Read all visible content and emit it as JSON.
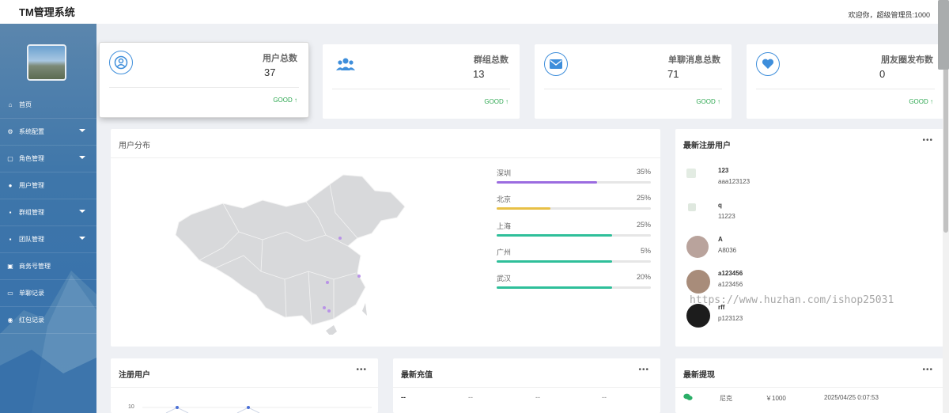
{
  "header": {
    "title": "TM管理系统",
    "welcome": "欢迎你，超级管理员:1000"
  },
  "sidebar": {
    "items": [
      {
        "label": "首页",
        "icon": "home-icon",
        "caret": false
      },
      {
        "label": "系统配置",
        "icon": "gear-icon",
        "caret": true
      },
      {
        "label": "角色管理",
        "icon": "lock-icon",
        "caret": true
      },
      {
        "label": "用户管理",
        "icon": "user-icon",
        "caret": false
      },
      {
        "label": "群组管理",
        "icon": "group-icon",
        "caret": true
      },
      {
        "label": "团队管理",
        "icon": "team-icon",
        "caret": true
      },
      {
        "label": "商务号管理",
        "icon": "contact-card-icon",
        "caret": false
      },
      {
        "label": "单聊记录",
        "icon": "chat-icon",
        "caret": false
      },
      {
        "label": "红包记录",
        "icon": "red-packet-icon",
        "caret": false
      }
    ]
  },
  "stats": [
    {
      "label": "用户总数",
      "value": "37",
      "status": "GOOD ↑",
      "icon": "user-circle-icon"
    },
    {
      "label": "群组总数",
      "value": "13",
      "status": "GOOD ↑",
      "icon": "users-group-icon"
    },
    {
      "label": "单聊消息总数",
      "value": "71",
      "status": "GOOD ↑",
      "icon": "envelope-icon"
    },
    {
      "label": "朋友圈发布数",
      "value": "0",
      "status": "GOOD ↑",
      "icon": "heart-icon"
    }
  ],
  "distribution": {
    "title": "用户分布",
    "cities": [
      {
        "name": "深圳",
        "pct": "35%",
        "fill": 0.65,
        "color": "#9b6ce0"
      },
      {
        "name": "北京",
        "pct": "25%",
        "fill": 0.35,
        "color": "#e8c046"
      },
      {
        "name": "上海",
        "pct": "25%",
        "fill": 0.75,
        "color": "#2fbf9a"
      },
      {
        "name": "广州",
        "pct": "5%",
        "fill": 0.75,
        "color": "#2fbf9a"
      },
      {
        "name": "武汉",
        "pct": "20%",
        "fill": 0.75,
        "color": "#2fbf9a"
      }
    ]
  },
  "latest_users": {
    "title": "最新注册用户",
    "more": "•••",
    "items": [
      {
        "name": "123",
        "id": "aaa123123",
        "avatar_color": "#e3ece3"
      },
      {
        "name": "q",
        "id": "11223",
        "avatar_color": "#dfe8df"
      },
      {
        "name": "A",
        "id": "A8036",
        "avatar_color": "#b9a39c"
      },
      {
        "name": "a123456",
        "id": "a123456",
        "avatar_color": "#a88c7a"
      },
      {
        "name": "rff",
        "id": "p123123",
        "avatar_color": "#1c1c1c"
      }
    ]
  },
  "watermark": "https://www.huzhan.com/ishop25031",
  "reg_users": {
    "title": "注册用户",
    "more": "•••",
    "axis_tick": "10"
  },
  "recharge": {
    "title": "最新充值",
    "more": "•••",
    "row": [
      "--",
      "--",
      "--",
      "--"
    ]
  },
  "withdraw": {
    "title": "最新提现",
    "more": "•••",
    "row": {
      "name": "尼克",
      "amount": "￥1000",
      "time": "2025/04/25 0:07:53"
    }
  }
}
